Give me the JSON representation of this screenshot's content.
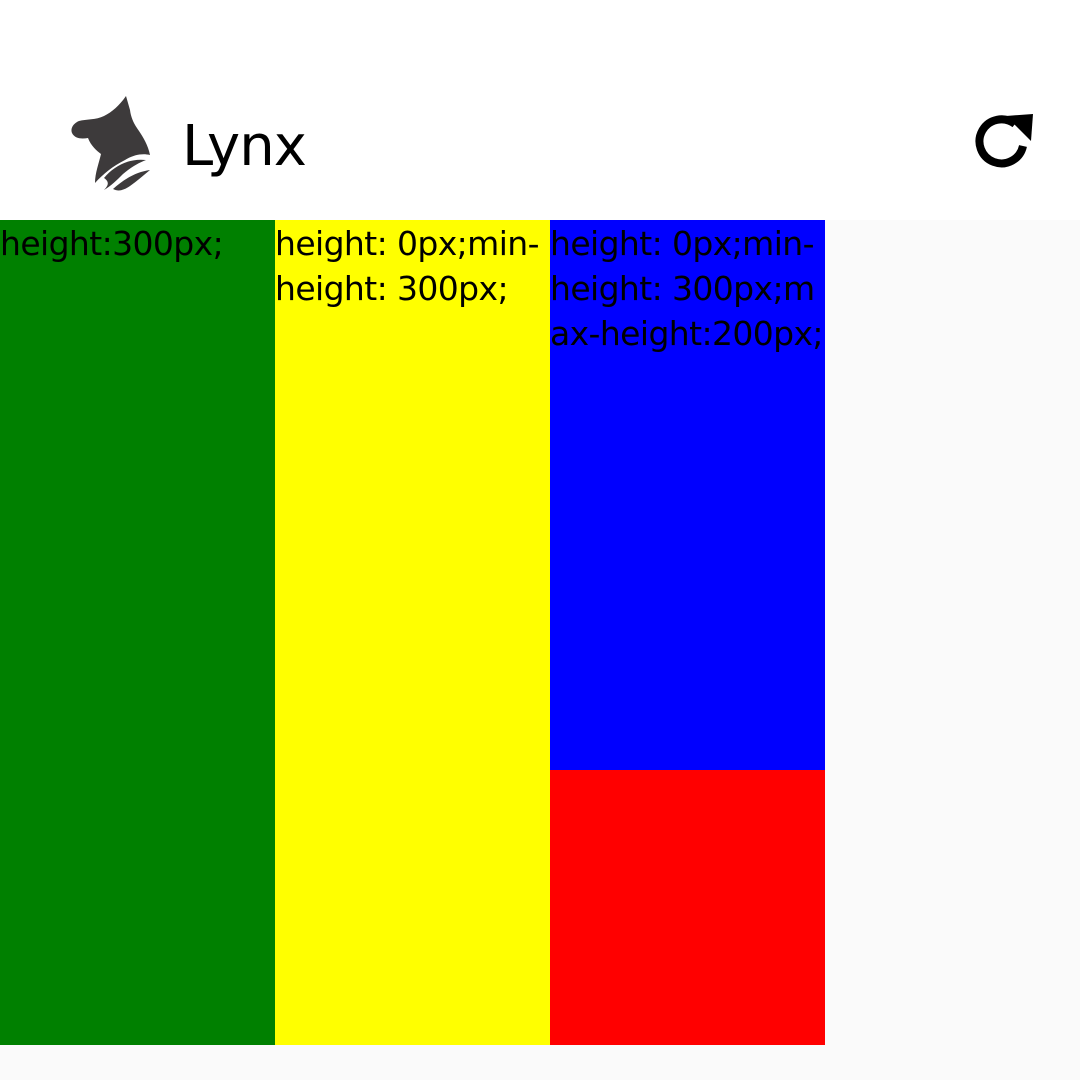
{
  "app": {
    "title": "Lynx",
    "logo_icon": "lynx-logo-icon",
    "refresh_icon": "refresh-icon"
  },
  "colors": {
    "header_bg": "#ffffff",
    "page_bg": "#fafafa",
    "green": "#008000",
    "yellow": "#ffff00",
    "blue": "#0000ff",
    "red": "#ff0000",
    "logo": "#3d3a3b"
  },
  "boxes": {
    "green": {
      "label": "height:300px;"
    },
    "yellow": {
      "label": "height: 0px;min-height: 300px;"
    },
    "blue": {
      "label": "height: 0px;min-height: 300px;max-height:200px;"
    },
    "red": {
      "label": ""
    }
  }
}
